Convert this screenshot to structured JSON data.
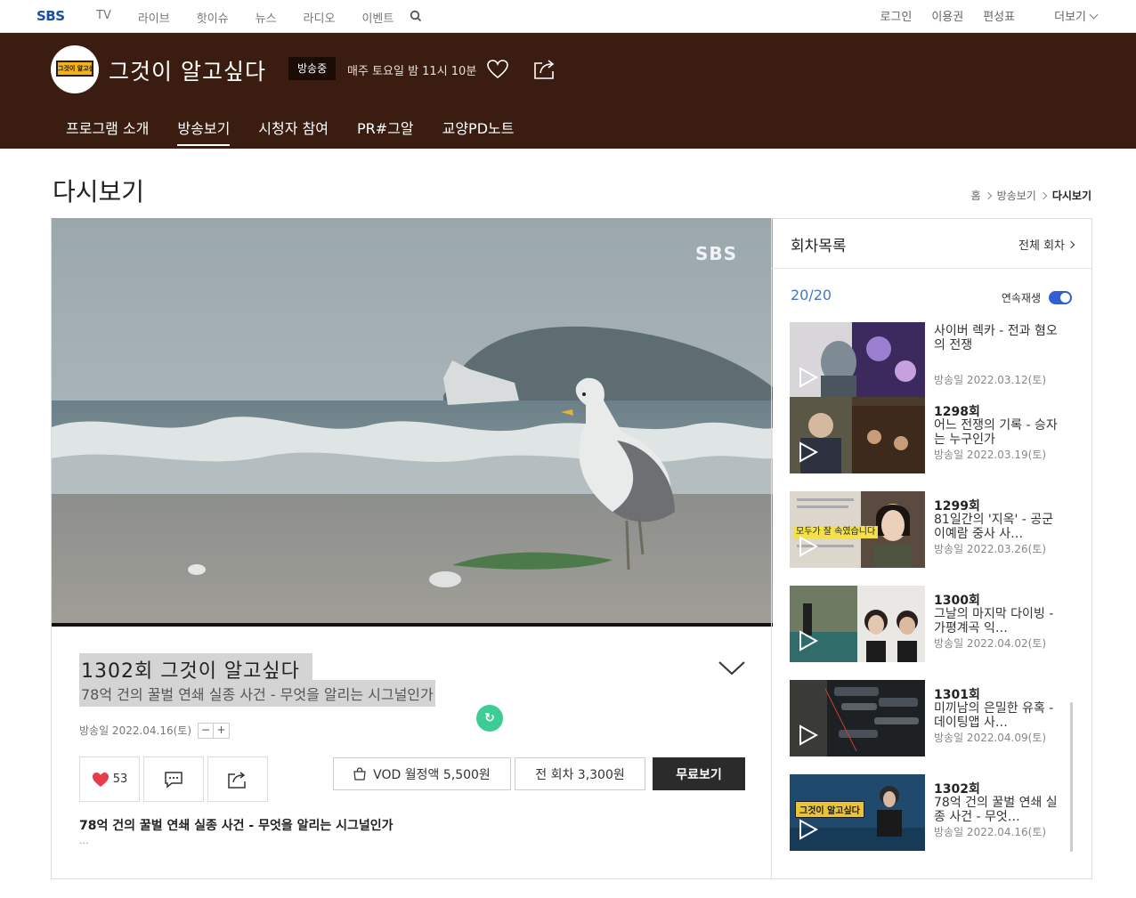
{
  "gnb": {
    "logo": "SBS",
    "menu": [
      "TV",
      "라이브",
      "핫이슈",
      "뉴스",
      "라디오",
      "이벤트"
    ],
    "right": [
      "로그인",
      "이용권",
      "편성표"
    ],
    "more": "더보기"
  },
  "program": {
    "logo_text": "그것이 알고싶다",
    "title": "그것이 알고싶다",
    "onair": "방송중",
    "schedule": "매주 토요일 밤 11시 10분",
    "tabs": [
      "프로그램 소개",
      "방송보기",
      "시청자 참여",
      "PR#그알",
      "교양PD노트"
    ],
    "active_tab": "방송보기"
  },
  "page": {
    "title": "다시보기",
    "breadcrumb": [
      "홈",
      "방송보기",
      "다시보기"
    ]
  },
  "player": {
    "watermark": "SBS"
  },
  "episode": {
    "title": "1302회 그것이 알고싶다",
    "subtitle": "78억 건의 꿀벌 연쇄 실종 사건 - 무엇을 알리는 시그널인가",
    "date": "방송일 2022.04.16(토)",
    "font_minus": "−",
    "font_plus": "+",
    "likes": "53",
    "vod_monthly": "VOD 월정액 5,500원",
    "all_episodes": "전 회차 3,300원",
    "free_watch": "무료보기",
    "description": "78억 건의 꿀벌 연쇄 실종 사건 - 무엇을 알리는 시그널인가",
    "ellipsis": "..."
  },
  "sidebar": {
    "title": "회차목록",
    "all_link": "전체 회차",
    "count": "20/20",
    "autoplay_label": "연속재생",
    "autoplay_on": true,
    "items": [
      {
        "no": "",
        "name": "사이버 렉카 - 전과 혐오의 전쟁",
        "date": "방송일 2022.03.12(토)"
      },
      {
        "no": "1298회",
        "name": "어느 전쟁의 기록 - 승자는 누구인가",
        "date": "방송일 2022.03.19(토)"
      },
      {
        "no": "1299회",
        "name": "81일간의 '지옥' - 공군 이예람 중사 사…",
        "date": "방송일 2022.03.26(토)"
      },
      {
        "no": "1300회",
        "name": "그날의 마지막 다이빙 - 가평계곡 익…",
        "date": "방송일 2022.04.02(토)"
      },
      {
        "no": "1301회",
        "name": "미끼남의 은밀한 유혹 - 데이팅앱 사…",
        "date": "방송일 2022.04.09(토)"
      },
      {
        "no": "1302회",
        "name": "78억 건의 꿀벌 연쇄 실종 사건 - 무엇…",
        "date": "방송일 2022.04.16(토)"
      }
    ],
    "thumb_captions": {
      "item3": "모두가 잘 속였습니다",
      "item6": "그것이 알고싶다"
    }
  },
  "colors": {
    "header_bg": "#3a1d10",
    "accent_blue": "#2f5fd0",
    "count_blue": "#4877c2",
    "like_red": "#e83c4a",
    "fab_green": "#3dcc96"
  }
}
